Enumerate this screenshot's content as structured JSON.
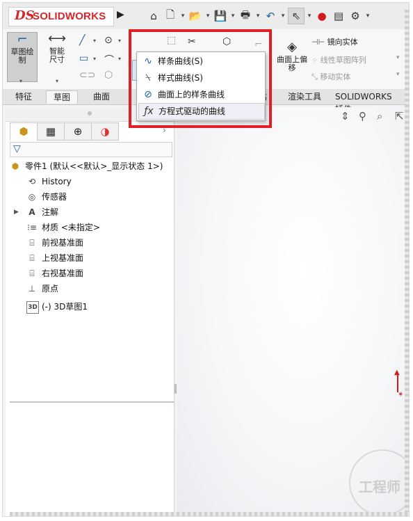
{
  "app": {
    "logo_mark": "DS",
    "logo_text": "SOLIDWORKS"
  },
  "ribbon": {
    "sketch_label": "草图绘制",
    "smart_dim_label": "智能尺寸",
    "offset_surface_label": "曲面上偏移",
    "mirror_label": "镜向实体",
    "linear_pattern_label": "线性草图阵列",
    "move_label": "移动实体"
  },
  "tabs": [
    "特征",
    "草图",
    "曲面",
    "渲染工具",
    "SOLIDWORKS 插件"
  ],
  "spline_menu": {
    "items": [
      {
        "label": "样条曲线(S)",
        "icon": "spline-icon"
      },
      {
        "label": "样式曲线(S)",
        "icon": "style-spline-icon"
      },
      {
        "label": "曲面上的样条曲线",
        "icon": "spline-on-surface-icon"
      },
      {
        "label": "方程式驱动的曲线",
        "icon": "equation-curve-icon"
      }
    ]
  },
  "tree": {
    "root": "零件1 (默认<<默认>_显示状态 1>)",
    "items": [
      {
        "label": "History",
        "icon": "history-icon"
      },
      {
        "label": "传感器",
        "icon": "sensor-icon"
      },
      {
        "label": "注解",
        "icon": "annotation-icon"
      },
      {
        "label": "材质 <未指定>",
        "icon": "material-icon"
      },
      {
        "label": "前视基准面",
        "icon": "plane-icon"
      },
      {
        "label": "上视基准面",
        "icon": "plane-icon"
      },
      {
        "label": "右视基准面",
        "icon": "plane-icon"
      },
      {
        "label": "原点",
        "icon": "origin-icon"
      },
      {
        "label": "(-) 3D草图1",
        "icon": "3d-sketch-icon"
      }
    ]
  },
  "watermark": {
    "text": "工程师"
  }
}
